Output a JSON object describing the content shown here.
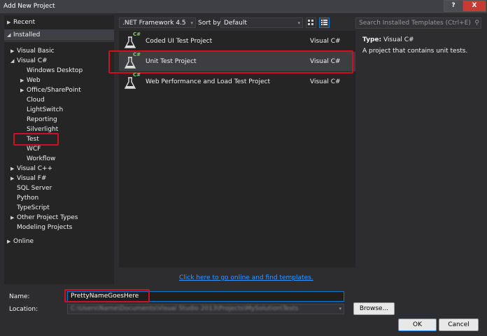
{
  "window": {
    "title": "Add New Project",
    "help_label": "?",
    "close_label": "X"
  },
  "tree": [
    {
      "label": "Recent",
      "arrow": "▶"
    },
    {
      "label": "Installed",
      "arrow": "◢"
    },
    {
      "label": "Visual Basic",
      "arrow": "▶"
    },
    {
      "label": "Visual C#",
      "arrow": "◢"
    },
    {
      "label": "Windows Desktop",
      "arrow": ""
    },
    {
      "label": "Web",
      "arrow": "▶"
    },
    {
      "label": "Office/SharePoint",
      "arrow": "▶"
    },
    {
      "label": "Cloud",
      "arrow": ""
    },
    {
      "label": "LightSwitch",
      "arrow": ""
    },
    {
      "label": "Reporting",
      "arrow": ""
    },
    {
      "label": "Silverlight",
      "arrow": ""
    },
    {
      "label": "Test",
      "arrow": ""
    },
    {
      "label": "WCF",
      "arrow": ""
    },
    {
      "label": "Workflow",
      "arrow": ""
    },
    {
      "label": "Visual C++",
      "arrow": "▶"
    },
    {
      "label": "Visual F#",
      "arrow": "▶"
    },
    {
      "label": "SQL Server",
      "arrow": ""
    },
    {
      "label": "Python",
      "arrow": ""
    },
    {
      "label": "TypeScript",
      "arrow": ""
    },
    {
      "label": "Other Project Types",
      "arrow": "▶"
    },
    {
      "label": "Modeling Projects",
      "arrow": ""
    },
    {
      "label": "Online",
      "arrow": "▶"
    }
  ],
  "toolbar": {
    "framework": ".NET Framework 4.5",
    "sort_label": "Sort by:",
    "sort_value": "Default",
    "dropdown_glyph": "▾"
  },
  "search": {
    "placeholder": "Search Installed Templates (Ctrl+E)",
    "icon_glyph": "⚲"
  },
  "templates": [
    {
      "name": "Coded UI Test Project",
      "lang": "Visual C#"
    },
    {
      "name": "Unit Test Project",
      "lang": "Visual C#"
    },
    {
      "name": "Web Performance and Load Test Project",
      "lang": "Visual C#"
    }
  ],
  "icon_badge": "C#",
  "details": {
    "type_label": "Type:",
    "type_value": "Visual C#",
    "description": "A project that contains unit tests."
  },
  "online_link": "Click here to go online and find templates.",
  "form": {
    "name_label": "Name:",
    "name_value": "PrettyNameGoesHere",
    "location_label": "Location:",
    "location_value": "C:\\Users\\Name\\Documents\\Visual Studio 2013\\Projects\\MySolution\\Tests",
    "browse_label": "Browse...",
    "ok_label": "OK",
    "cancel_label": "Cancel"
  },
  "colors": {
    "accent": "#007acc",
    "highlight": "#d0101e",
    "link": "#3399ff"
  }
}
